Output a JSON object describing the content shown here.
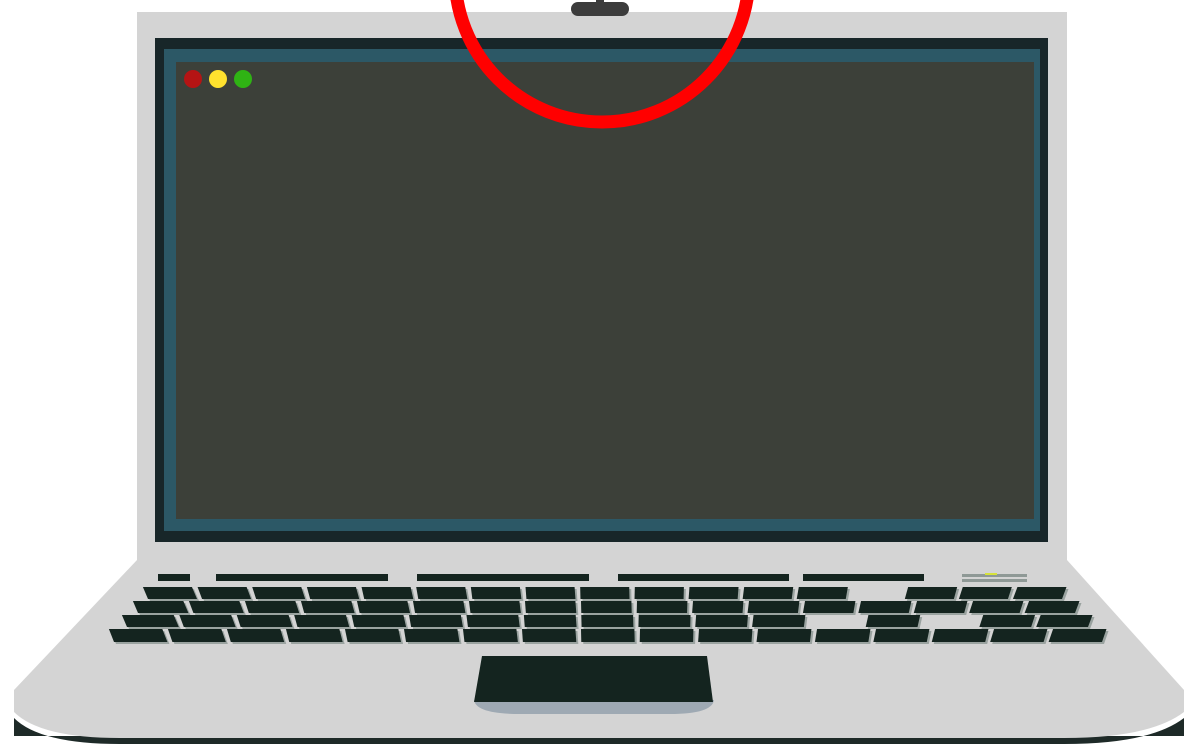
{
  "illustration": {
    "subject": "laptop",
    "colors": {
      "body": "#d4d4d4",
      "body_edge": "#1e2a28",
      "bezel": "#182629",
      "screen_frame": "#2c5866",
      "screen": "#3c4039",
      "keys": "#14241f",
      "key_shadow": "#9aa3a0",
      "trackpad": "#14241f",
      "trackpad_base": "#9ea9b3",
      "webcam": "#3c3c3c",
      "highlight_ring": "#ff0000"
    },
    "window_controls": [
      {
        "name": "close",
        "color": "#b51414"
      },
      {
        "name": "minimize",
        "color": "#ffe22e"
      },
      {
        "name": "maximize",
        "color": "#2fb314"
      }
    ],
    "annotation": {
      "type": "highlight-circle",
      "target": "webcam",
      "color": "#ff0000"
    }
  }
}
